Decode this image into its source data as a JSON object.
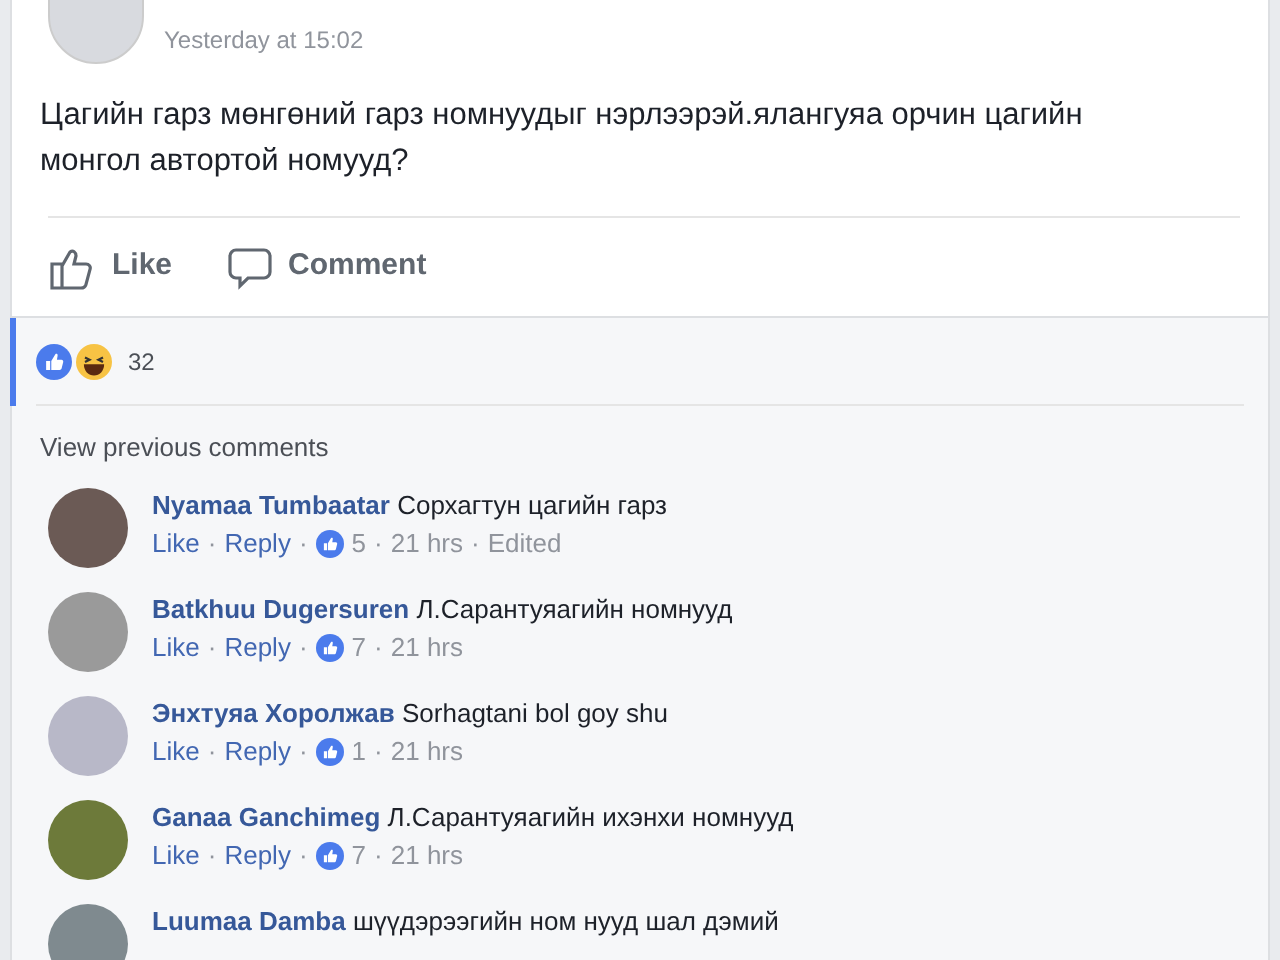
{
  "post": {
    "timestamp": "Yesterday at 15:02",
    "text": "Цагийн гарз мөнгөний гарз номнуудыг нэрлээрэй.ялангуяа орчин цагийн монгол автортой номууд?",
    "actions": [
      {
        "kind": "like",
        "label": "Like"
      },
      {
        "kind": "comment",
        "label": "Comment"
      }
    ]
  },
  "reactions": {
    "count": "32"
  },
  "view_previous": "View previous comments",
  "separator": "·",
  "comments": [
    {
      "name": "Nyamaa Tumbaatar",
      "text": "Сорхагтун цагийн гарз",
      "like": "Like",
      "reply": "Reply",
      "likes": "5",
      "time": "21 hrs",
      "edited": "Edited"
    },
    {
      "name": "Batkhuu Dugersuren",
      "text": "Л.Сарантуяагийн номнууд",
      "like": "Like",
      "reply": "Reply",
      "likes": "7",
      "time": "21 hrs"
    },
    {
      "name": "Энхтуяа Хоролжав",
      "text": "Sorhagtani bol goy shu",
      "like": "Like",
      "reply": "Reply",
      "likes": "1",
      "time": "21 hrs"
    },
    {
      "name": "Ganaa Ganchimeg",
      "text": "Л.Сарантуяагийн ихэнхи номнууд",
      "like": "Like",
      "reply": "Reply",
      "likes": "7",
      "time": "21 hrs"
    },
    {
      "name": "Luumaa Damba",
      "text": "шүүдэрээгийн ном нууд шал дэмий"
    }
  ]
}
